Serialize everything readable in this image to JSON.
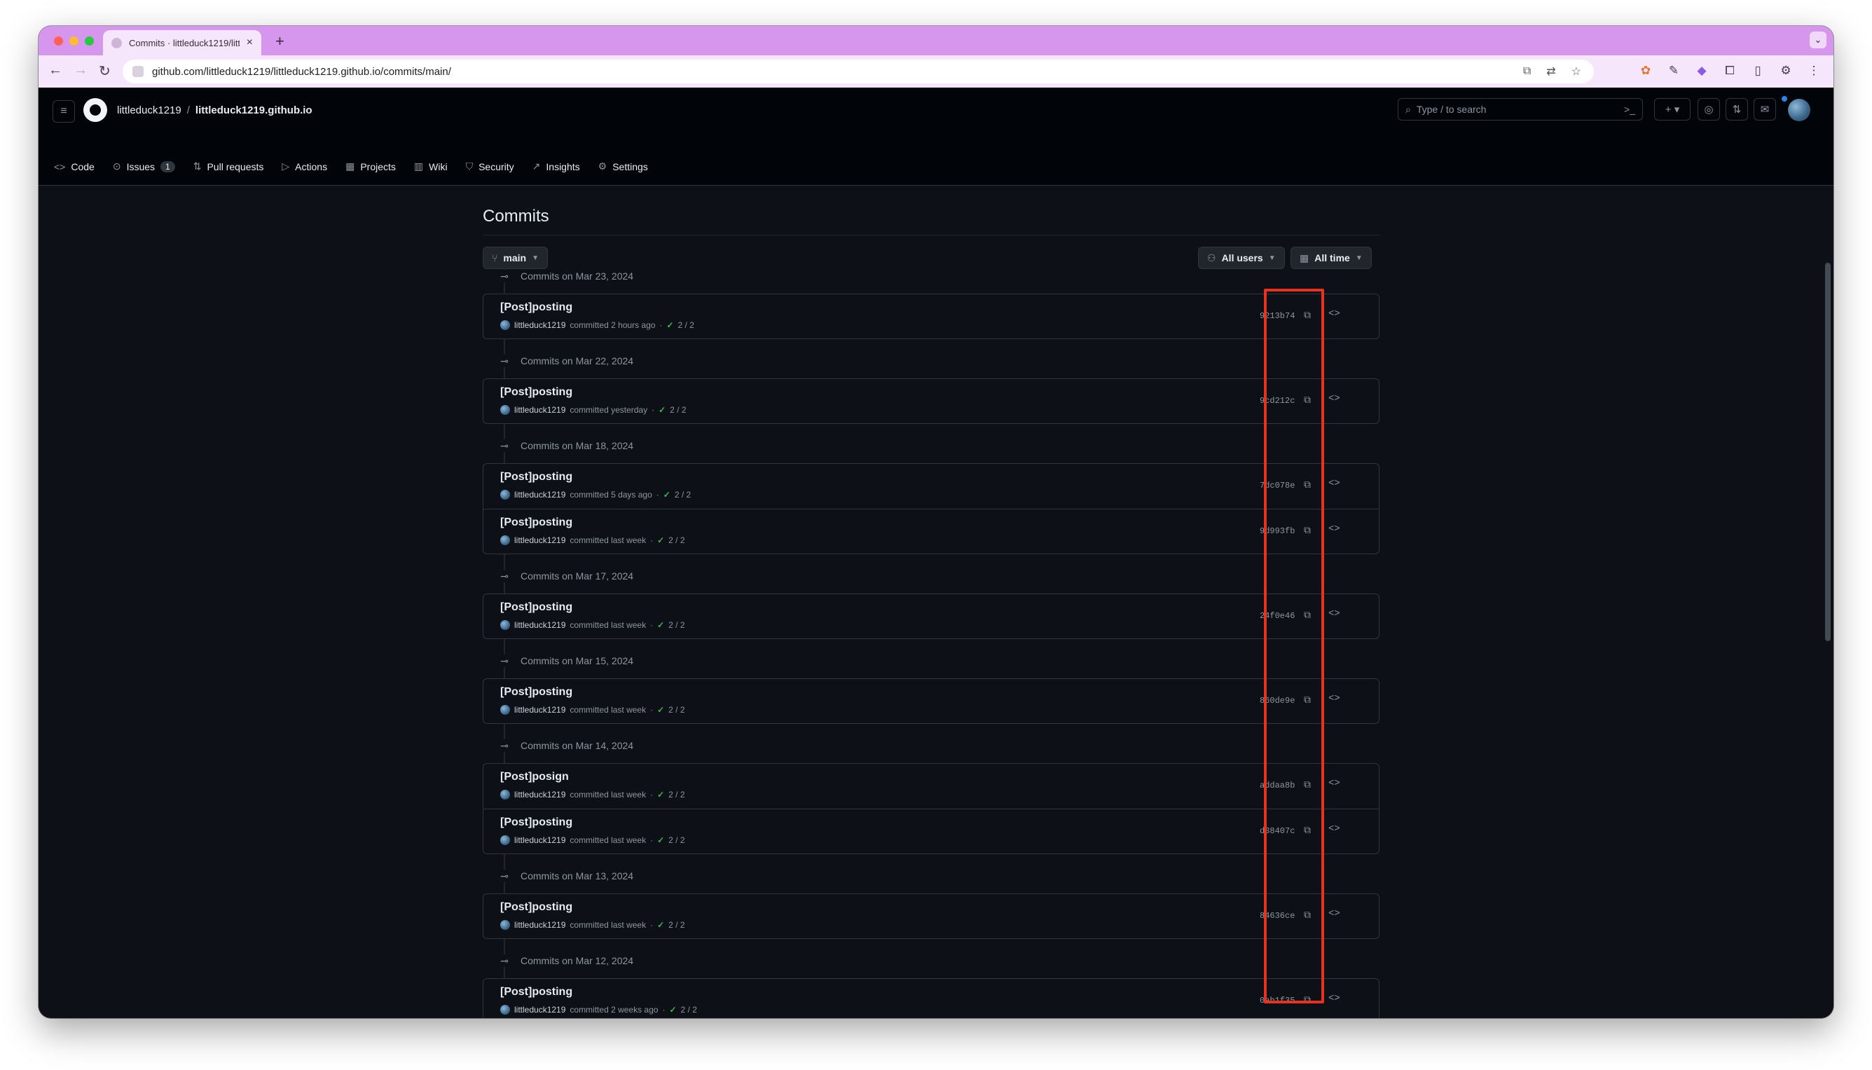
{
  "browser": {
    "tab_title": "Commits · littleduck1219/littleduck1219.github.io",
    "url": "github.com/littleduck1219/littleduck1219.github.io/commits/main/"
  },
  "header": {
    "owner": "littleduck1219",
    "separator": "/",
    "repo": "littleduck1219.github.io",
    "search_placeholder": "Type / to search"
  },
  "repo_nav": [
    {
      "label": "Code",
      "icon": "code-icon"
    },
    {
      "label": "Issues",
      "icon": "issue-icon",
      "count": "1"
    },
    {
      "label": "Pull requests",
      "icon": "pull-request-icon"
    },
    {
      "label": "Actions",
      "icon": "play-icon"
    },
    {
      "label": "Projects",
      "icon": "table-icon"
    },
    {
      "label": "Wiki",
      "icon": "book-icon"
    },
    {
      "label": "Security",
      "icon": "shield-icon"
    },
    {
      "label": "Insights",
      "icon": "graph-icon"
    },
    {
      "label": "Settings",
      "icon": "gear-icon"
    }
  ],
  "page": {
    "title": "Commits",
    "branch": "main",
    "users_filter": "All users",
    "time_filter": "All time"
  },
  "groups": [
    {
      "date": "Commits on Mar 23, 2024",
      "commits": [
        {
          "message": "[Post]posting",
          "author": "littleduck1219",
          "when": "committed 2 hours ago",
          "checks": "2 / 2",
          "sha": "9213b74"
        }
      ]
    },
    {
      "date": "Commits on Mar 22, 2024",
      "commits": [
        {
          "message": "[Post]posting",
          "author": "littleduck1219",
          "when": "committed yesterday",
          "checks": "2 / 2",
          "sha": "9cd212c"
        }
      ]
    },
    {
      "date": "Commits on Mar 18, 2024",
      "commits": [
        {
          "message": "[Post]posting",
          "author": "littleduck1219",
          "when": "committed 5 days ago",
          "checks": "2 / 2",
          "sha": "7dc078e"
        },
        {
          "message": "[Post]posting",
          "author": "littleduck1219",
          "when": "committed last week",
          "checks": "2 / 2",
          "sha": "9d993fb"
        }
      ]
    },
    {
      "date": "Commits on Mar 17, 2024",
      "commits": [
        {
          "message": "[Post]posting",
          "author": "littleduck1219",
          "when": "committed last week",
          "checks": "2 / 2",
          "sha": "24f0e46"
        }
      ]
    },
    {
      "date": "Commits on Mar 15, 2024",
      "commits": [
        {
          "message": "[Post]posting",
          "author": "littleduck1219",
          "when": "committed last week",
          "checks": "2 / 2",
          "sha": "860de9e"
        }
      ]
    },
    {
      "date": "Commits on Mar 14, 2024",
      "commits": [
        {
          "message": "[Post]posign",
          "author": "littleduck1219",
          "when": "committed last week",
          "checks": "2 / 2",
          "sha": "addaa8b"
        },
        {
          "message": "[Post]posting",
          "author": "littleduck1219",
          "when": "committed last week",
          "checks": "2 / 2",
          "sha": "d38407c"
        }
      ]
    },
    {
      "date": "Commits on Mar 13, 2024",
      "commits": [
        {
          "message": "[Post]posting",
          "author": "littleduck1219",
          "when": "committed last week",
          "checks": "2 / 2",
          "sha": "84636ce"
        }
      ]
    },
    {
      "date": "Commits on Mar 12, 2024",
      "commits": [
        {
          "message": "[Post]posting",
          "author": "littleduck1219",
          "when": "committed 2 weeks ago",
          "checks": "2 / 2",
          "sha": "0ab1f35"
        }
      ]
    }
  ],
  "colors": {
    "highlight": "#e8321f",
    "tabbar": "#d796ee",
    "background": "#0d1117",
    "success": "#3fb950"
  }
}
